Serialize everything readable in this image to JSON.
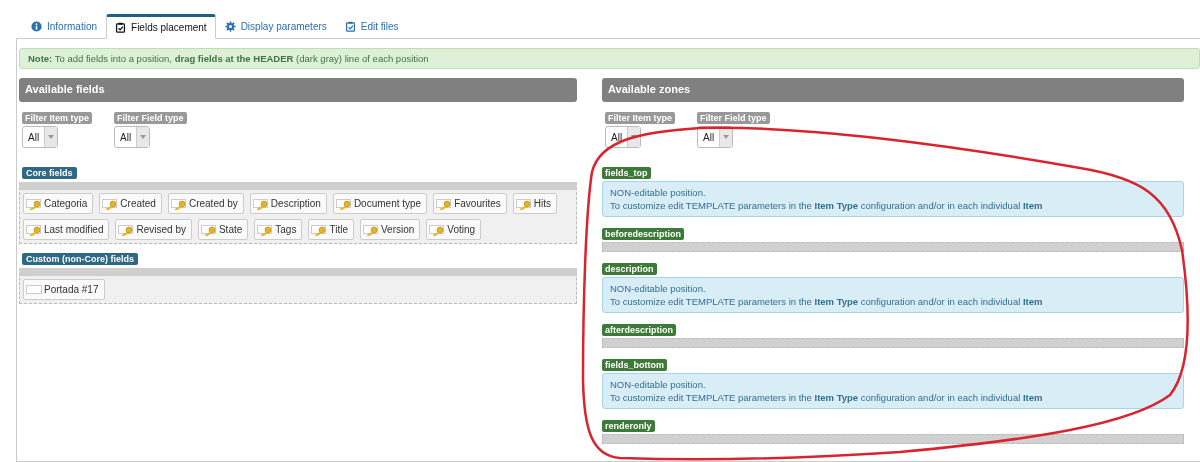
{
  "tabs": [
    {
      "label": "Information",
      "kind": "info",
      "selected": false
    },
    {
      "label": "Fields placement",
      "kind": "checklist",
      "selected": true
    },
    {
      "label": "Display parameters",
      "kind": "gear",
      "selected": false
    },
    {
      "label": "Edit files",
      "kind": "checklist",
      "selected": false
    }
  ],
  "note": "**Note:** To add fields into a position, **drag fields at the HEADER** (dark gray) line of each position",
  "available_fields": {
    "title": "Available fields",
    "filters": [
      {
        "label": "Filter Item type",
        "value": "All"
      },
      {
        "label": "Filter Field type",
        "value": "All"
      }
    ],
    "groups": [
      {
        "label": "Core fields",
        "fields": [
          {
            "label": "Categoria",
            "kind": "key"
          },
          {
            "label": "Created",
            "kind": "key"
          },
          {
            "label": "Created by",
            "kind": "key"
          },
          {
            "label": "Description",
            "kind": "key"
          },
          {
            "label": "Document type",
            "kind": "key"
          },
          {
            "label": "Favourites",
            "kind": "key"
          },
          {
            "label": "Hits",
            "kind": "key"
          },
          {
            "label": "Last modified",
            "kind": "key"
          },
          {
            "label": "Revised by",
            "kind": "key"
          },
          {
            "label": "State",
            "kind": "key"
          },
          {
            "label": "Tags",
            "kind": "key"
          },
          {
            "label": "Title",
            "kind": "key"
          },
          {
            "label": "Version",
            "kind": "key"
          },
          {
            "label": "Voting",
            "kind": "key"
          }
        ]
      },
      {
        "label": "Custom (non-Core) fields",
        "fields": [
          {
            "label": "Portada #17",
            "kind": "plain"
          }
        ]
      }
    ]
  },
  "available_zones": {
    "title": "Available zones",
    "filters": [
      {
        "label": "Filter Item type",
        "value": "All"
      },
      {
        "label": "Filter Field type",
        "value": "All"
      }
    ],
    "zones": [
      {
        "label": "fields_top",
        "kind": "locked",
        "lines": [
          "NON-editable position.",
          "To customize edit TEMPLATE parameters in the **Item Type** configuration and/or in each individual **Item**"
        ]
      },
      {
        "label": "beforedescription",
        "kind": "drop"
      },
      {
        "label": "description",
        "kind": "locked",
        "lines": [
          "NON-editable position.",
          "To customize edit TEMPLATE parameters in the **Item Type** configuration and/or in each individual **Item**"
        ]
      },
      {
        "label": "afterdescription",
        "kind": "drop"
      },
      {
        "label": "fields_bottom",
        "kind": "locked",
        "lines": [
          "NON-editable position.",
          "To customize edit TEMPLATE parameters in the **Item Type** configuration and/or in each individual **Item**"
        ]
      },
      {
        "label": "renderonly",
        "kind": "drop"
      }
    ]
  }
}
